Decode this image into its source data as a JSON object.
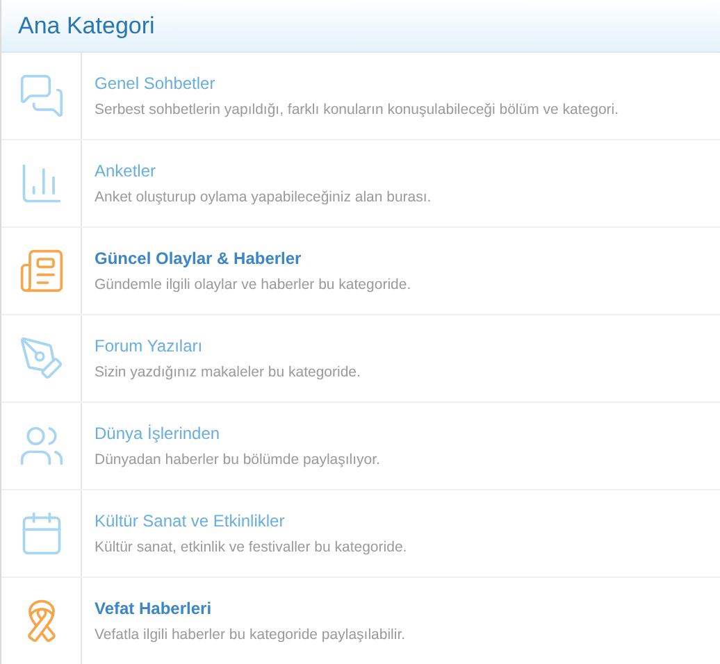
{
  "header": {
    "title": "Ana Kategori"
  },
  "categories": [
    {
      "kind": "chat",
      "featured": false,
      "title": "Genel Sohbetler",
      "description": "Serbest sohbetlerin yapıldığı, farklı konuların konuşulabileceği bölüm ve kategori."
    },
    {
      "kind": "poll",
      "featured": false,
      "title": "Anketler",
      "description": "Anket oluşturup oylama yapabileceğiniz alan burası."
    },
    {
      "kind": "news",
      "featured": true,
      "title": "Güncel Olaylar & Haberler",
      "description": "Gündemle ilgili olaylar ve haberler bu kategoride."
    },
    {
      "kind": "pen",
      "featured": false,
      "title": "Forum Yazıları",
      "description": "Sizin yazdığınız makaleler bu kategoride."
    },
    {
      "kind": "people",
      "featured": false,
      "title": "Dünya İşlerinden",
      "description": "Dünyadan haberler bu bölümde paylaşılıyor."
    },
    {
      "kind": "calendar",
      "featured": false,
      "title": "Kültür Sanat ve Etkinlikler",
      "description": "Kültür sanat, etkinlik ve festivaller bu kategoride."
    },
    {
      "kind": "ribbon",
      "featured": true,
      "title": "Vefat Haberleri",
      "description": "Vefatla ilgili haberler bu kategoride paylaşılabilir."
    }
  ]
}
